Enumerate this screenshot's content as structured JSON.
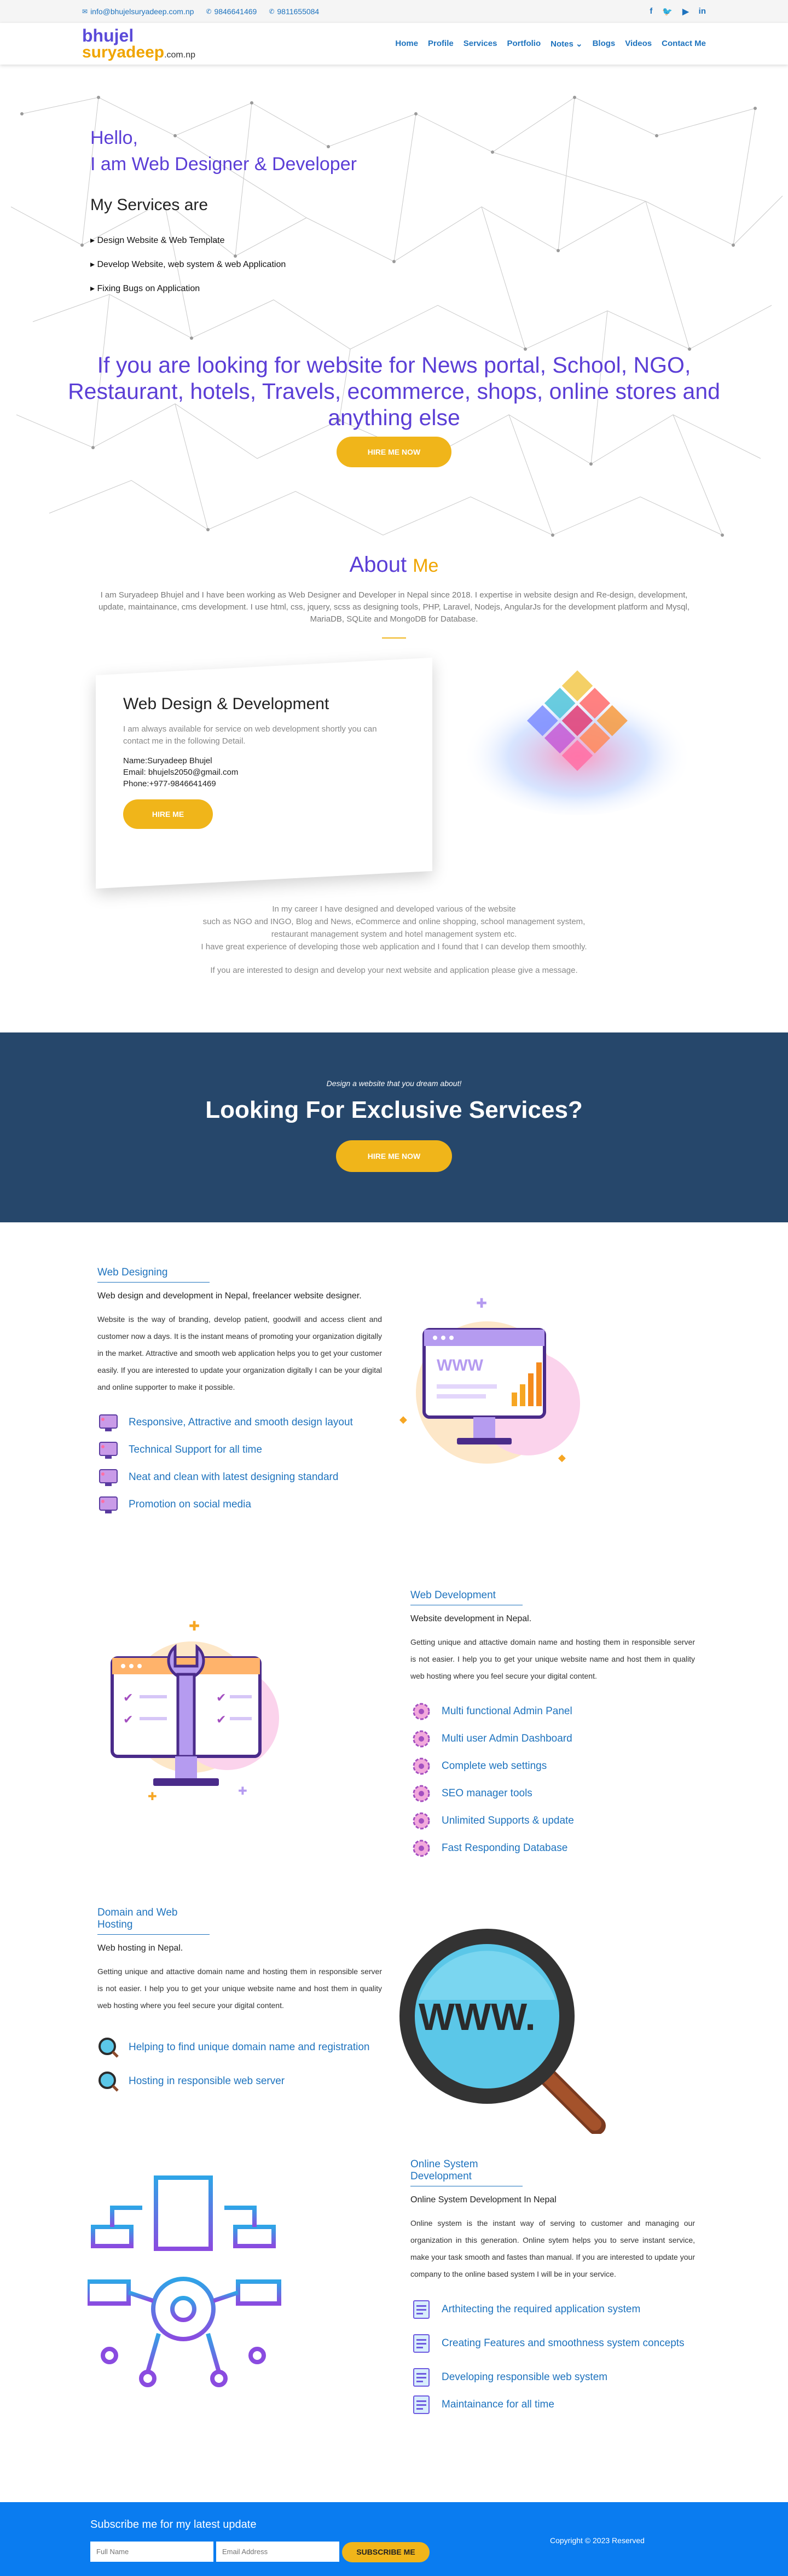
{
  "topbar": {
    "email": "info@bhujelsuryadeep.com.np",
    "phone1": "9846641469",
    "phone2": "9811655084",
    "social": [
      "f",
      "t",
      "yt",
      "in"
    ]
  },
  "logo": {
    "line1": "bhujel",
    "line2": "suryadeep",
    "suffix": ".com.np"
  },
  "nav": [
    "Home",
    "Profile",
    "Services",
    "Portfolio",
    "Notes",
    "Blogs",
    "Videos",
    "Contact Me"
  ],
  "hero": {
    "hello": "Hello,",
    "intro": "I am Web Designer & Developer",
    "services_title": "My Services are",
    "services": [
      "Design Website & Web Template",
      "Develop Website, web system & web Application",
      "Fixing Bugs on Application"
    ],
    "big_text": "If you are looking for website for News portal, School, NGO, Restaurant, hotels, Travels, ecommerce, shops, online stores and anything else",
    "cta": "HIRE ME NOW"
  },
  "about": {
    "title": "About",
    "title_accent": "Me",
    "para": "I am Suryadeep Bhujel and I have been working as Web Designer and Developer in Nepal since 2018. I expertise in website design and Re-design, development, update, maintainance, cms development. I use html, css, jquery, scss as designing tools, PHP, Laravel, Nodejs, AngularJs for the development platform and Mysql, MariaDB, SQLite and MongoDB for Database."
  },
  "card": {
    "title": "Web Design & Development",
    "text": "I am always available for service on web development shortly you can contact me in the following Detail.",
    "name": "Name:Suryadeep Bhujel",
    "email": "Email: bhujels2050@gmail.com",
    "phone": "Phone:+977-9846641469",
    "button": "HIRE ME"
  },
  "story": {
    "lines": [
      "In my career I have designed and developed various of the website",
      "such as NGO and INGO, Blog and News, eCommerce and online shopping, school management system,",
      "restaurant management system and hotel management system etc.",
      "I have great experience of developing those web application and I found that I can develop them smoothly."
    ],
    "contact": "If you are interested to design and develop your next website and application please give a message."
  },
  "banner": {
    "small": "Design a website that you dream about!",
    "title": "Looking For Exclusive Services?",
    "button": "HIRE ME NOW"
  },
  "services": [
    {
      "title": "Web Designing",
      "sub": "Web design and development in Nepal, freelancer website designer.",
      "desc": "Website is the way of branding, develop patient, goodwill and access client and customer now a days. It is the instant means of promoting your organization digitally in the market. Attractive and smooth web application helps you to get your customer easily. If you are interested to update your organization digitally I can be your digital and online supporter to make it possible.",
      "features": [
        "Responsive, Attractive and smooth design layout",
        "Technical Support for all time",
        "Neat and clean with latest designing standard",
        "Promotion on social media"
      ]
    },
    {
      "title": "Web Development",
      "sub": "Website development in Nepal.",
      "desc": "Getting unique and attactive domain name and hosting them in responsible server is not easier. I help you to get your unique website name and host them in quality web hosting where you feel secure your digital content.",
      "features": [
        "Multi functional Admin Panel",
        "Multi user Admin Dashboard",
        "Complete web settings",
        "SEO manager tools",
        "Unlimited Supports & update",
        "Fast Responding Database"
      ]
    },
    {
      "title": "Domain and Web Hosting",
      "sub": "Web hosting in Nepal.",
      "desc": "Getting unique and attactive domain name and hosting them in responsible server is not easier. I help you to get your unique website name and host them in quality web hosting where you feel secure your digital content.",
      "features": [
        "Helping to find unique domain name and registration",
        "Hosting in responsible web server"
      ]
    },
    {
      "title": "Online System Development",
      "sub": "Online System Development In Nepal",
      "desc": "Online system is the instant way of serving to customer and managing our organization in this generation. Online sytem helps you to serve instant service, make your task smooth and fastes than manual. If you are interested to update your company to the online based system I will be in your service.",
      "features": [
        "Arthitecting the required application system",
        "Creating Features and smoothness system concepts",
        "Developing responsible web system",
        "Maintainance for all time"
      ]
    }
  ],
  "footer": {
    "subscribe_title": "Subscribe me for my latest update",
    "name_placeholder": "Full Name",
    "email_placeholder": "Email Address",
    "button": "SUBSCRIBE ME",
    "copyright": "Copyright © 2023 Reserved"
  },
  "colors": {
    "primary": "#5b3ed6",
    "accent": "#f0b51a",
    "link": "#1e73be",
    "banner": "#26476b",
    "footer": "#0a7cf0"
  }
}
